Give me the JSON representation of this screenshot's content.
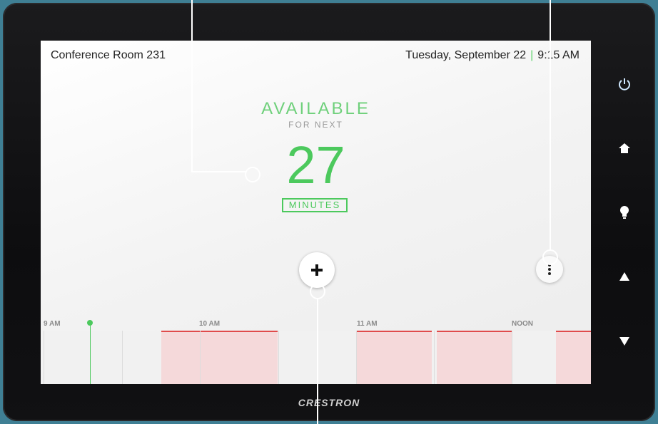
{
  "header": {
    "room_name": "Conference Room 231",
    "date": "Tuesday, September 22",
    "time": "9:15 AM"
  },
  "availability": {
    "status": "AVAILABLE",
    "sub": "FOR NEXT",
    "minutes": "27",
    "unit": "MINUTES"
  },
  "actions": {
    "add_icon": "plus-icon",
    "more_icon": "more-options-icon"
  },
  "timeline": {
    "labels": [
      "9 AM",
      "10 AM",
      "11 AM",
      "NOON"
    ],
    "current_time_marker": "9:15 AM"
  },
  "device_buttons": [
    "power-icon",
    "home-icon",
    "light-bulb-icon",
    "up-arrow-icon",
    "down-arrow-icon"
  ],
  "brand": "CRESTRON",
  "colors": {
    "available_green": "#4cc95d",
    "booked_fill": "#f5d9da",
    "booked_border": "#e04b4b",
    "bezel": "#111113",
    "background": "#3f7f94"
  }
}
